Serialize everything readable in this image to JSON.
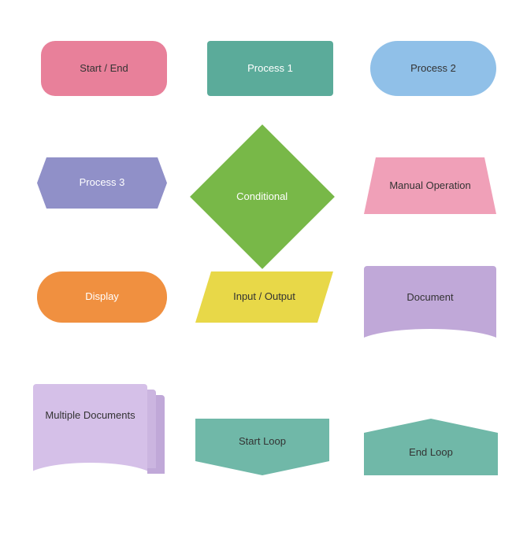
{
  "shapes": {
    "startEnd": {
      "label": "Start / End"
    },
    "process1": {
      "label": "Process 1"
    },
    "process2": {
      "label": "Process 2"
    },
    "process3": {
      "label": "Process 3"
    },
    "conditional": {
      "label": "Conditional"
    },
    "manualOp": {
      "label": "Manual Operation"
    },
    "display": {
      "label": "Display"
    },
    "inputOutput": {
      "label": "Input / Output"
    },
    "document": {
      "label": "Document"
    },
    "multipleDocuments": {
      "label": "Multiple Documents"
    },
    "startLoop": {
      "label": "Start Loop"
    },
    "endLoop": {
      "label": "End Loop"
    }
  }
}
